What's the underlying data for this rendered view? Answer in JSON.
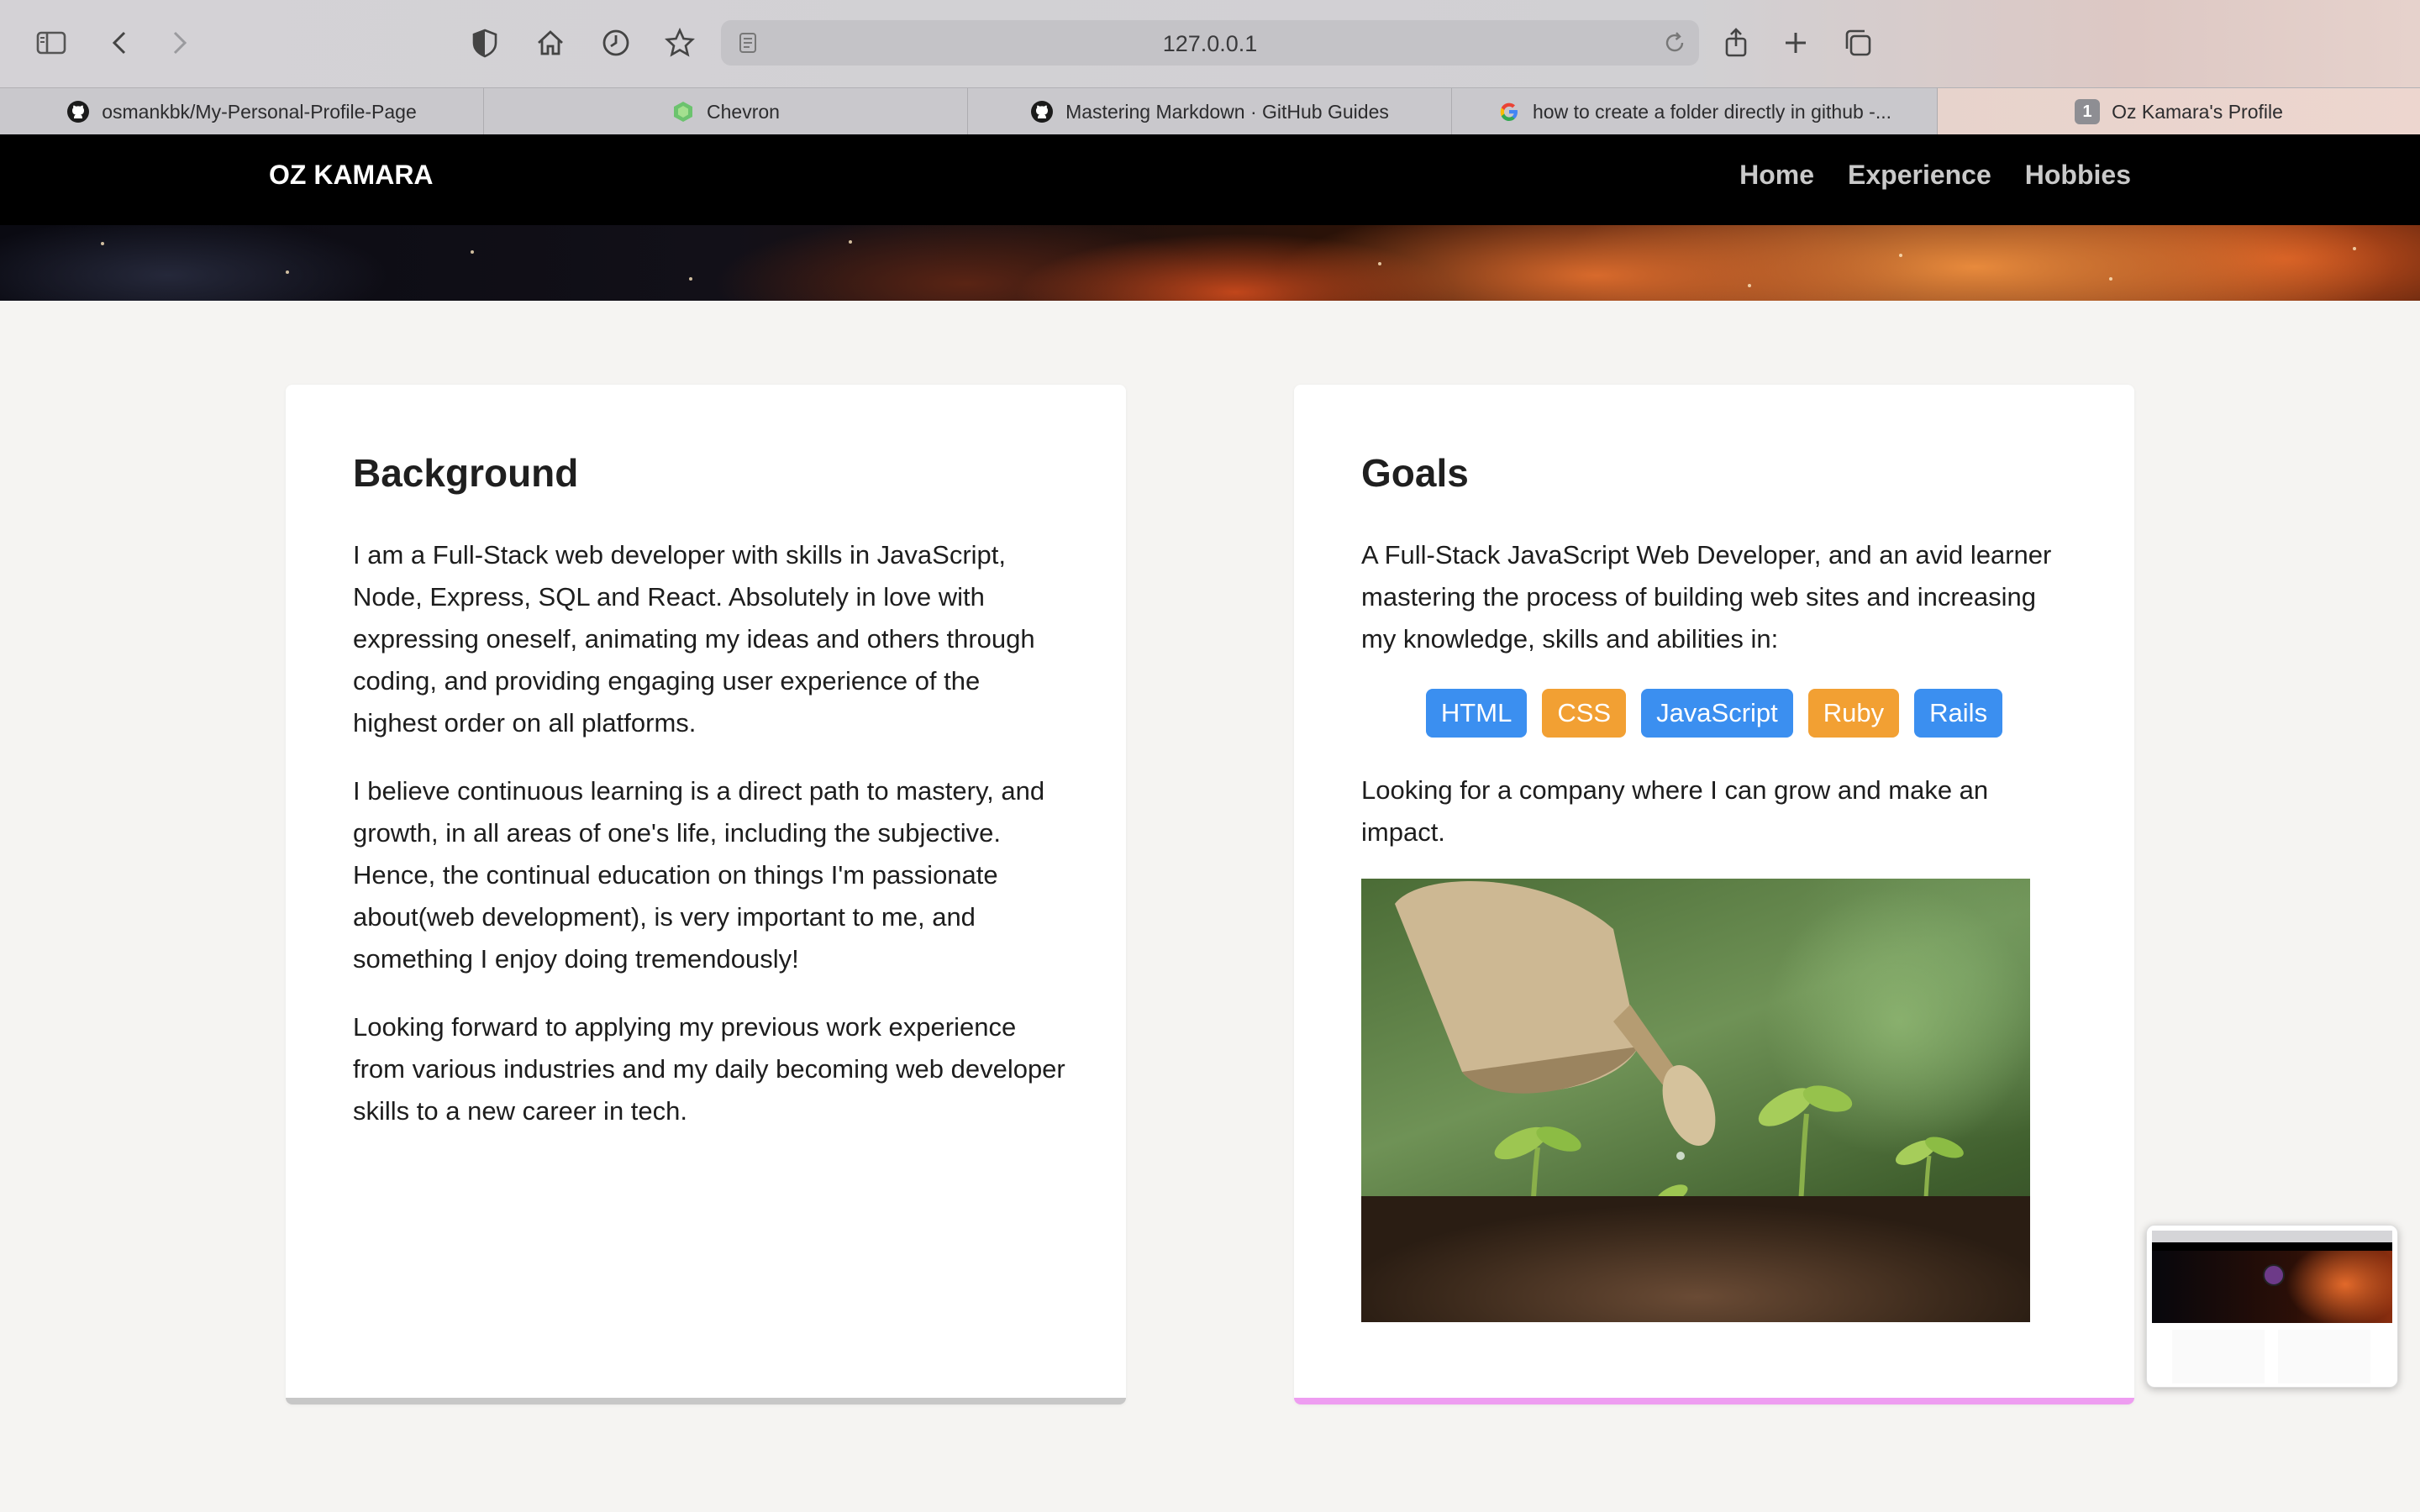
{
  "browser": {
    "url": "127.0.0.1",
    "tabs": [
      {
        "title": "osmankbk/My-Personal-Profile-Page",
        "icon": "github-icon",
        "active": false
      },
      {
        "title": "Chevron",
        "icon": "chevron-logo-icon",
        "active": false
      },
      {
        "title": "Mastering Markdown · GitHub Guides",
        "icon": "github-icon",
        "active": false
      },
      {
        "title": "how to create a folder directly in github -...",
        "icon": "google-icon",
        "active": false
      },
      {
        "title": "Oz Kamara's Profile",
        "icon": "tab-number-badge",
        "badge": "1",
        "active": true
      }
    ]
  },
  "site": {
    "brand": "OZ KAMARA",
    "nav": [
      "Home",
      "Experience",
      "Hobbies"
    ]
  },
  "background": {
    "heading": "Background",
    "paragraphs": [
      "I am a Full-Stack web developer with skills in JavaScript, Node, Express, SQL and React. Absolutely in love with expressing oneself, animating my ideas and others through coding, and providing engaging user experience of the highest order on all platforms.",
      "I believe continuous learning is a direct path to mastery, and growth, in all areas of one's life, including the subjective. Hence, the continual education on things I'm passionate about(web development), is very important to me, and something I enjoy doing tremendously!",
      "Looking forward to applying my previous work experience from various industries and my daily becoming web developer skills to a new career in tech."
    ]
  },
  "goals": {
    "heading": "Goals",
    "intro": "A Full-Stack JavaScript Web Developer, and an avid learner mastering the process of building web sites and increasing my knowledge, skills and abilities in:",
    "skills": [
      {
        "label": "HTML",
        "color": "#3b8ff0"
      },
      {
        "label": "CSS",
        "color": "#f2a033"
      },
      {
        "label": "JavaScript",
        "color": "#3b8ff0"
      },
      {
        "label": "Ruby",
        "color": "#f2a033"
      },
      {
        "label": "Rails",
        "color": "#3b8ff0"
      }
    ],
    "closing": "Looking for a company where I can grow and make an impact.",
    "image": "watering-can-seedlings-photo"
  },
  "colors": {
    "nav_bg": "#000000",
    "card_left_border": "#c7c7c7",
    "card_right_border": "#ee9df1"
  }
}
